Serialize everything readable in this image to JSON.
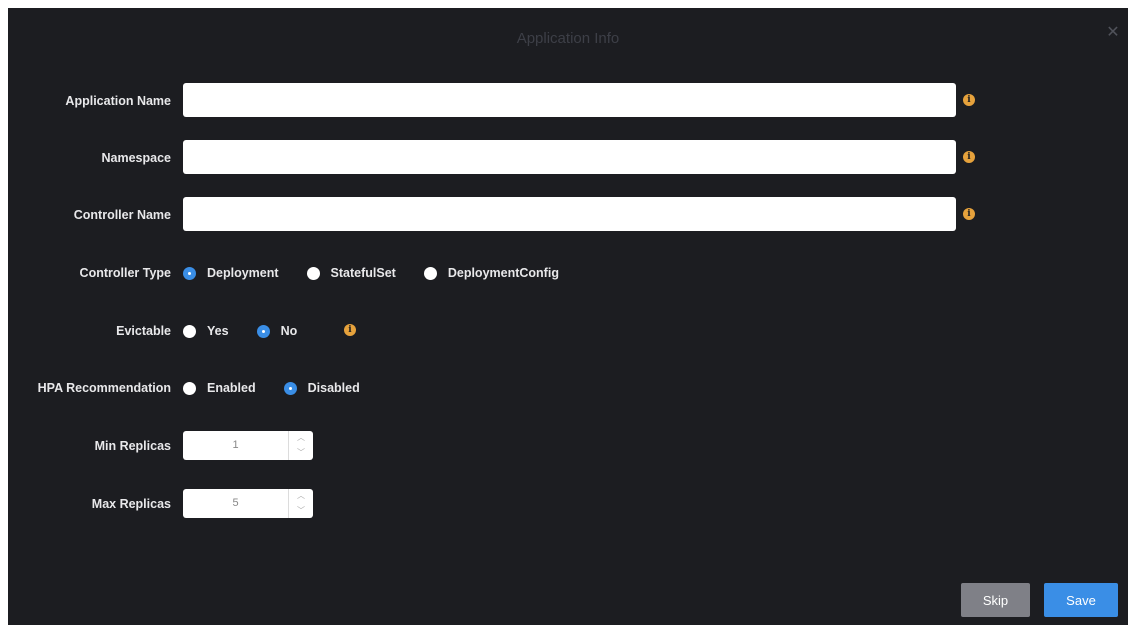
{
  "dialog": {
    "title": "Application Info",
    "close_icon": "close-icon"
  },
  "fields": {
    "application_name": {
      "label": "Application Name",
      "value": "",
      "placeholder": ""
    },
    "namespace": {
      "label": "Namespace",
      "value": "",
      "placeholder": ""
    },
    "controller_name": {
      "label": "Controller Name",
      "value": "",
      "placeholder": ""
    }
  },
  "controller_type": {
    "label": "Controller Type",
    "options": [
      {
        "label": "Deployment",
        "selected": true
      },
      {
        "label": "StatefulSet",
        "selected": false
      },
      {
        "label": "DeploymentConfig",
        "selected": false
      }
    ]
  },
  "evictable": {
    "label": "Evictable",
    "options": [
      {
        "label": "Yes",
        "selected": false
      },
      {
        "label": "No",
        "selected": true
      }
    ]
  },
  "hpa_recommendation": {
    "label": "HPA Recommendation",
    "options": [
      {
        "label": "Enabled",
        "selected": false
      },
      {
        "label": "Disabled",
        "selected": true
      }
    ]
  },
  "min_replicas": {
    "label": "Min Replicas",
    "value": "1"
  },
  "max_replicas": {
    "label": "Max Replicas",
    "value": "5"
  },
  "footer": {
    "skip_label": "Skip",
    "save_label": "Save"
  },
  "colors": {
    "background": "#1c1d21",
    "accent": "#3a8ee6",
    "info": "#e6a23c",
    "skip": "#7f8087"
  },
  "icons": {
    "info": "info-icon",
    "stepper_up": "chevron-up-icon",
    "stepper_down": "chevron-down-icon"
  }
}
